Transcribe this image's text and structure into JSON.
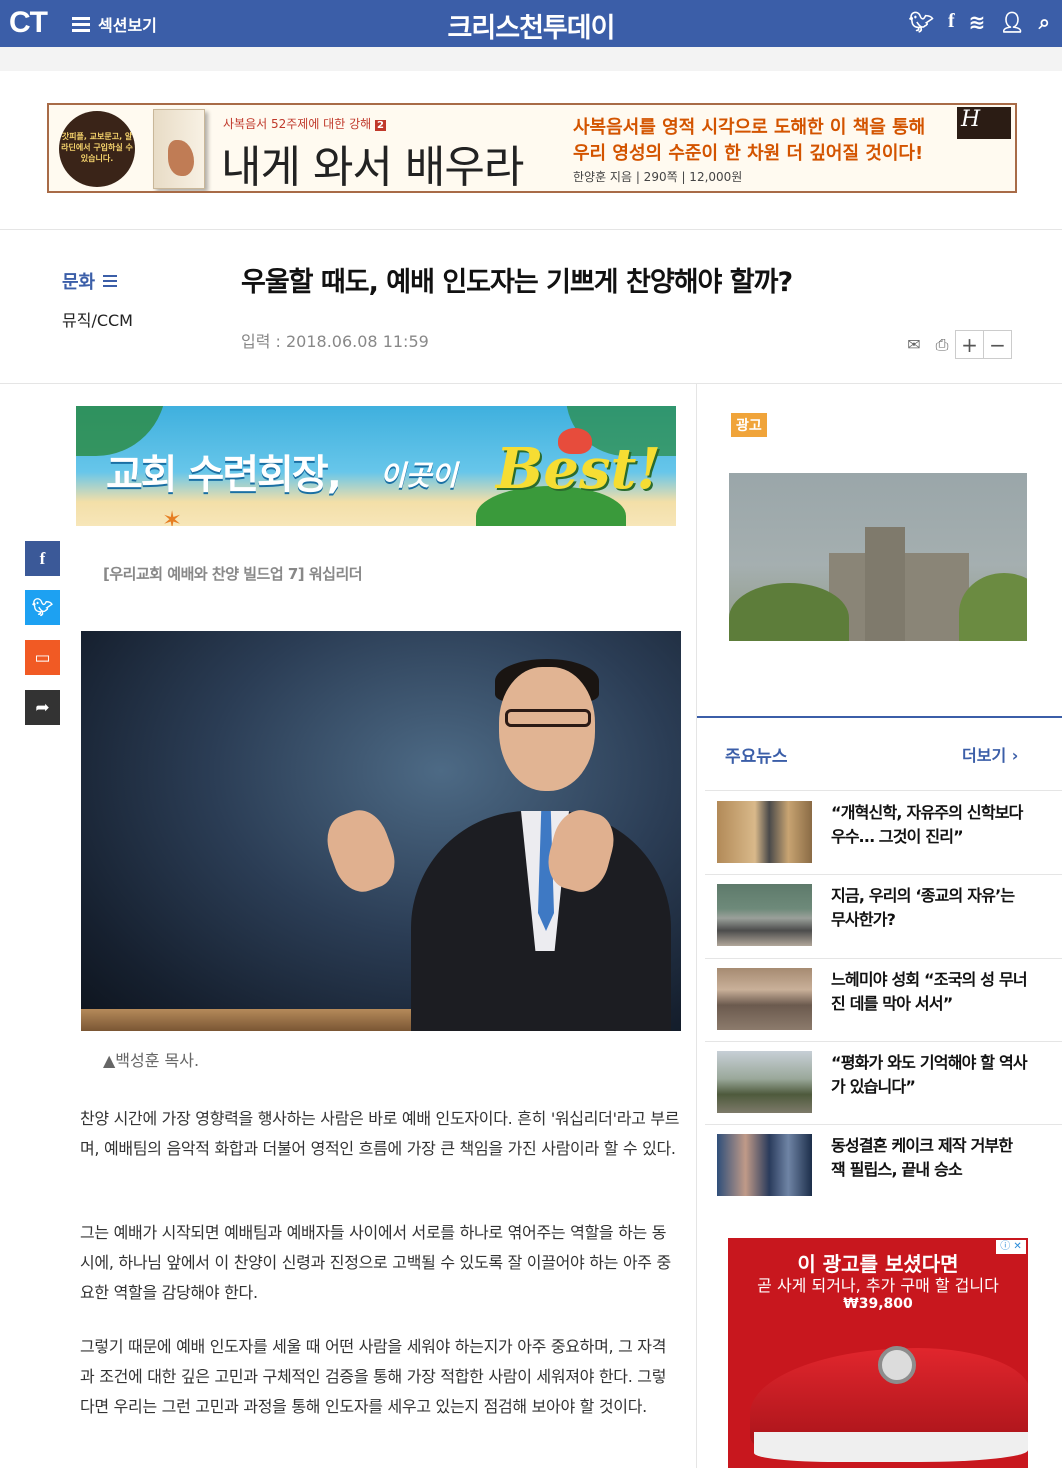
{
  "topbar": {
    "logo": "CT",
    "menu_label": "섹션보기",
    "site_name": "크리스천투데이",
    "icons": [
      "twitter-icon",
      "facebook-icon",
      "rss-icon",
      "user-icon",
      "search-icon"
    ]
  },
  "book_ad": {
    "badge": "갓피플, 교보문고, 알라딘에서 구입하실 수 있습니다.",
    "subtitle": "사복음서 52주제에 대한 강해",
    "volume": "2",
    "title": "내게 와서 배우라",
    "desc_line1": "사복음서를 영적 시각으로 도해한 이 책을 통해",
    "desc_line2": "우리 영성의 수준이 한 차원 더 깊어질 것이다!",
    "meta": "한양훈 지음 | 290쪽 | 12,000원",
    "publisher_logo": "H"
  },
  "article": {
    "section": "문화",
    "subsection": "뮤직/CCM",
    "headline": "우울할 때도, 예배 인도자는 기쁘게 찬양해야 할까?",
    "date": "입력 : 2018.06.08 11:59",
    "series": "[우리교회 예배와 찬양 빌드업 7] 워십리더",
    "caption": "▲백성훈 목사.",
    "paragraphs": [
      "찬양 시간에 가장 영향력을 행사하는 사람은 바로 예배 인도자이다. 흔히 '워십리더'라고 부르며, 예배팀의 음악적 화합과 더불어 영적인 흐름에 가장 큰 책임을 가진 사람이라 할 수 있다.",
      "그는 예배가 시작되면 예배팀과 예배자들 사이에서 서로를 하나로 엮어주는 역할을 하는 동시에, 하나님 앞에서 이 찬양이 신령과 진정으로 고백될 수 있도록 잘 이끌어야 하는 아주 중요한 역할을 감당해야 한다.",
      "그렇기 때문에 예배 인도자를 세울 때 어떤 사람을 세워야 하는지가 아주 중요하며, 그 자격과 조건에 대한 깊은 고민과 구체적인 검증을 통해 가장 적합한 사람이 세워져야 한다. 그렇다면 우리는 그런 고민과 과정을 통해 인도자를 세우고 있는지 점검해 보아야 할 것이다."
    ]
  },
  "tools": {
    "zoom_in": "+",
    "zoom_out": "−"
  },
  "retreat_ad": {
    "text1": "교회 수련회장,",
    "text2": "이곳이",
    "best": "Best!"
  },
  "sidebar": {
    "ad_label": "광고",
    "news_title": "주요뉴스",
    "more_label": "더보기 ›",
    "news": [
      {
        "title": "“개혁신학, 자유주의 신학보다 우수… 그것이 진리”"
      },
      {
        "title": "지금, 우리의 ‘종교의 자유’는 무사한가?"
      },
      {
        "title": "느헤미야 성회 “조국의 성 무너진 데를 막아 서서”"
      },
      {
        "title": "“평화가 와도 기억해야 할 역사가 있습니다”"
      },
      {
        "title": "동성결혼 케이크 제작 거부한 잭 필립스, 끝내 승소"
      }
    ]
  },
  "shoe_ad": {
    "line1": "이 광고를 보셨다면",
    "line2": "곧 사게 되거나, 추가 구매 할 겁니다",
    "price": "₩39,800",
    "badge": "ⓘ ✕"
  },
  "colors": {
    "brand": "#3b5ea8",
    "ad_label": "#f0a43a",
    "facebook": "#3b5998",
    "twitter": "#1da1f2",
    "comment": "#f15a24",
    "share": "#333333"
  }
}
